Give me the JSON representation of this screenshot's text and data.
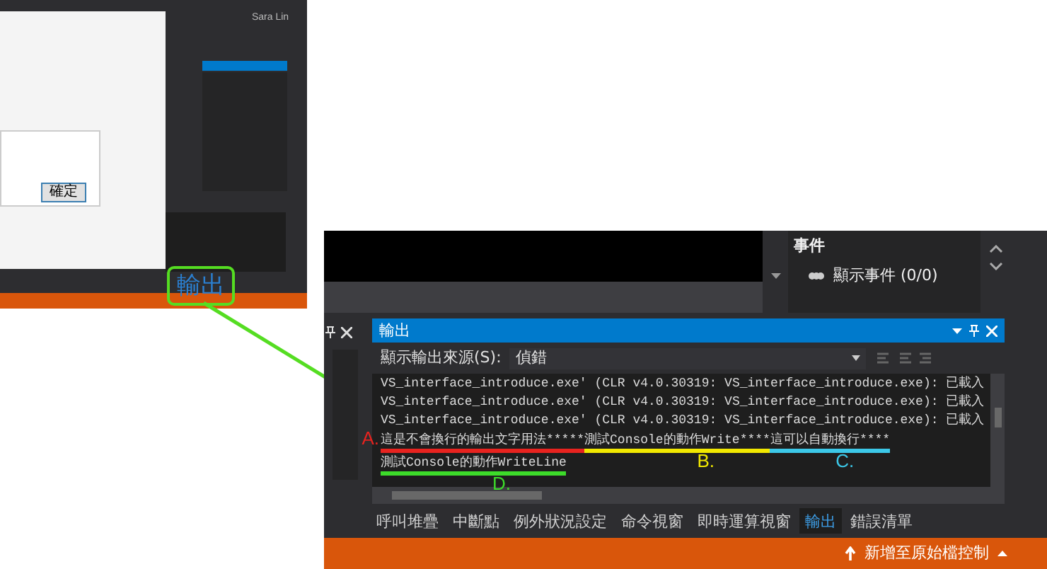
{
  "thumbnail": {
    "user_name": "Sara Lin",
    "ok_button": "確定",
    "callout": "輸出"
  },
  "zoomed": {
    "events_panel": {
      "heading": "事件",
      "item": "顯示事件 (0/0)"
    },
    "output_window": {
      "title": "輸出",
      "source_label": "顯示輸出來源(S):",
      "source_value": "偵錯",
      "lines": [
        "VS_interface_introduce.exe' (CLR v4.0.30319: VS_interface_introduce.exe): 已載入",
        "VS_interface_introduce.exe' (CLR v4.0.30319: VS_interface_introduce.exe): 已載入",
        "VS_interface_introduce.exe' (CLR v4.0.30319: VS_interface_introduce.exe): 已載入"
      ],
      "annotated_lines": [
        {
          "segments": [
            {
              "text": "這是不會換行的輸出文字用法*****",
              "color": "#e8231f",
              "label": "A.",
              "kind": "left"
            },
            {
              "text": "測試Console的動作Write****",
              "color": "#f2e800",
              "label": "B.",
              "kind": "below"
            },
            {
              "text": "這可以自動換行****",
              "color": "#3cc8e8",
              "label": "C.",
              "kind": "below"
            }
          ]
        },
        {
          "segments": [
            {
              "text": "測試Console的動作WriteLine",
              "color": "#3ddc2a",
              "label": "D.",
              "kind": "below"
            }
          ]
        }
      ]
    },
    "bottom_tabs": [
      {
        "label": "呼叫堆疊",
        "selected": false
      },
      {
        "label": "中斷點",
        "selected": false
      },
      {
        "label": "例外狀況設定",
        "selected": false
      },
      {
        "label": "命令視窗",
        "selected": false
      },
      {
        "label": "即時運算視窗",
        "selected": false
      },
      {
        "label": "輸出",
        "selected": true
      },
      {
        "label": "錯誤清單",
        "selected": false
      }
    ],
    "status_bar": {
      "text": "新增至原始檔控制"
    }
  }
}
